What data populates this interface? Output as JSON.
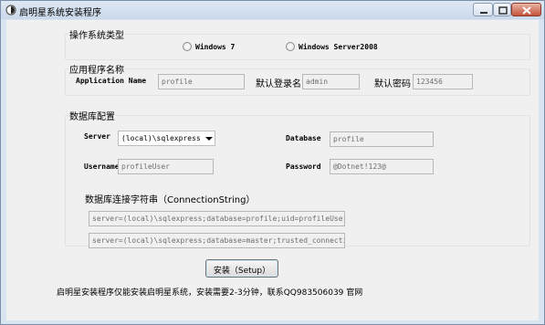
{
  "window": {
    "title": "启明星系统安装程序"
  },
  "os_group": {
    "legend": "操作系统类型",
    "options": [
      {
        "label": "Windows 7"
      },
      {
        "label": "Windows Server2008"
      }
    ]
  },
  "app_group": {
    "legend": "应用程序名称",
    "app_name_label": "Application Name",
    "app_name_value": "profile",
    "login_label": "默认登录名",
    "login_value": "admin",
    "password_label": "默认密码",
    "password_value": "123456"
  },
  "db_group": {
    "legend": "数据库配置",
    "server_label": "Server",
    "server_value": "(local)\\sqlexpress",
    "database_label": "Database",
    "database_value": "profile",
    "username_label": "Username",
    "username_value": "profileUser",
    "password_label": "Password",
    "password_value": "@Dotnet!123@",
    "connstr_label": "数据库连接字符串（ConnectionString）",
    "connstr1": "server=(local)\\sqlexpress;database=profile;uid=profileUser;pwd=",
    "connstr2": "server=(local)\\sqlexpress;database=master;trusted_connection=yes"
  },
  "install_button": "安装（Setup）",
  "footer": "启明星安装程序仅能安装启明星系统，安装需要2-3分钟，联系QQ983506039 官网"
}
